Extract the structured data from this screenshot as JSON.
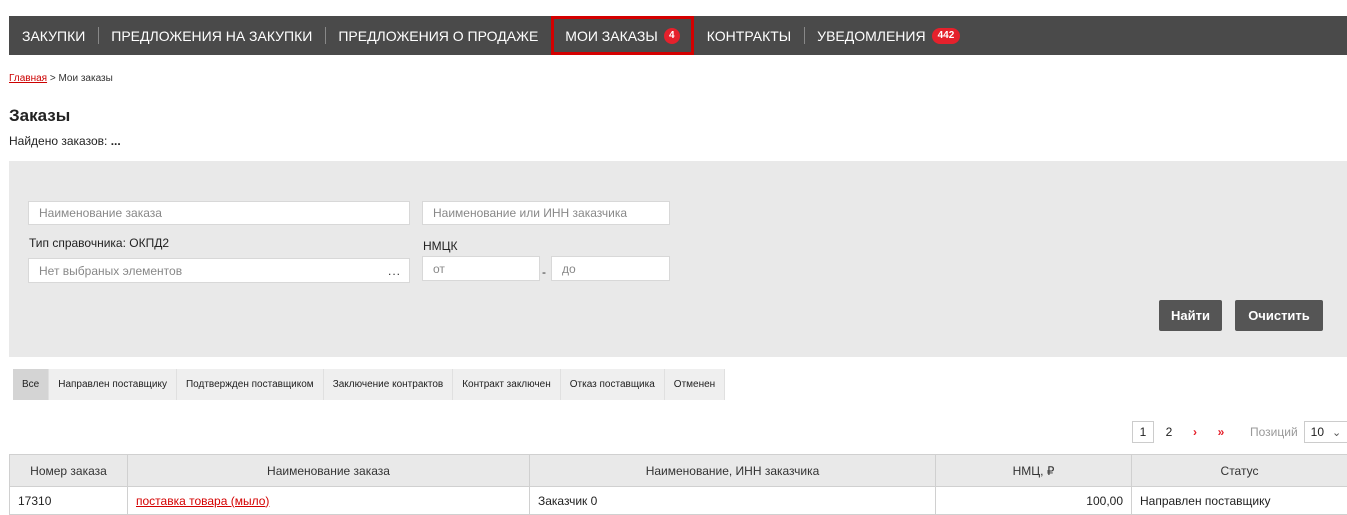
{
  "nav": {
    "items": [
      {
        "label": "Закупки"
      },
      {
        "label": "Предложения на закупки"
      },
      {
        "label": "Предложения о продаже"
      },
      {
        "label": "Мои заказы",
        "badge": "4"
      },
      {
        "label": "Контракты"
      },
      {
        "label": "Уведомления",
        "badge": "442"
      }
    ]
  },
  "breadcrumb": {
    "home": "Главная",
    "separator": " > ",
    "current": "Мои заказы"
  },
  "page": {
    "title": "Заказы",
    "found_label": "Найдено заказов:",
    "found_value": "..."
  },
  "filter": {
    "order_name_placeholder": "Наименование заказа",
    "customer_placeholder": "Наименование или ИНН заказчика",
    "ref_type_label": "Тип справочника: ОКПД2",
    "ref_placeholder": "Нет выбраных элементов",
    "ref_dots": "...",
    "nmck_label": "НМЦК",
    "from_placeholder": "от",
    "to_placeholder": "до",
    "range_dash": "-",
    "find_label": "Найти",
    "clear_label": "Очистить"
  },
  "tabs": [
    "Все",
    "Направлен поставщику",
    "Подтвержден поставщиком",
    "Заключение контрактов",
    "Контракт заключен",
    "Отказ поставщика",
    "Отменен"
  ],
  "pager": {
    "pages": [
      "1",
      "2"
    ],
    "next": "›",
    "last": "»",
    "positions_label": "Позиций",
    "positions_value": "10"
  },
  "table": {
    "headers": [
      "Номер заказа",
      "Наименование заказа",
      "Наименование, ИНН заказчика",
      "НМЦ, ₽",
      "Статус"
    ],
    "rows": [
      {
        "number": "17310",
        "name": "поставка товара (мыло)",
        "customer": "Заказчик 0",
        "price": "100,00",
        "status": "Направлен поставщику"
      }
    ]
  },
  "colors": {
    "nav_bg": "#4a4a4a",
    "accent": "#e5212c",
    "active_outline": "#d40000",
    "filter_bg": "#e9e9e9",
    "button_bg": "#555555"
  }
}
